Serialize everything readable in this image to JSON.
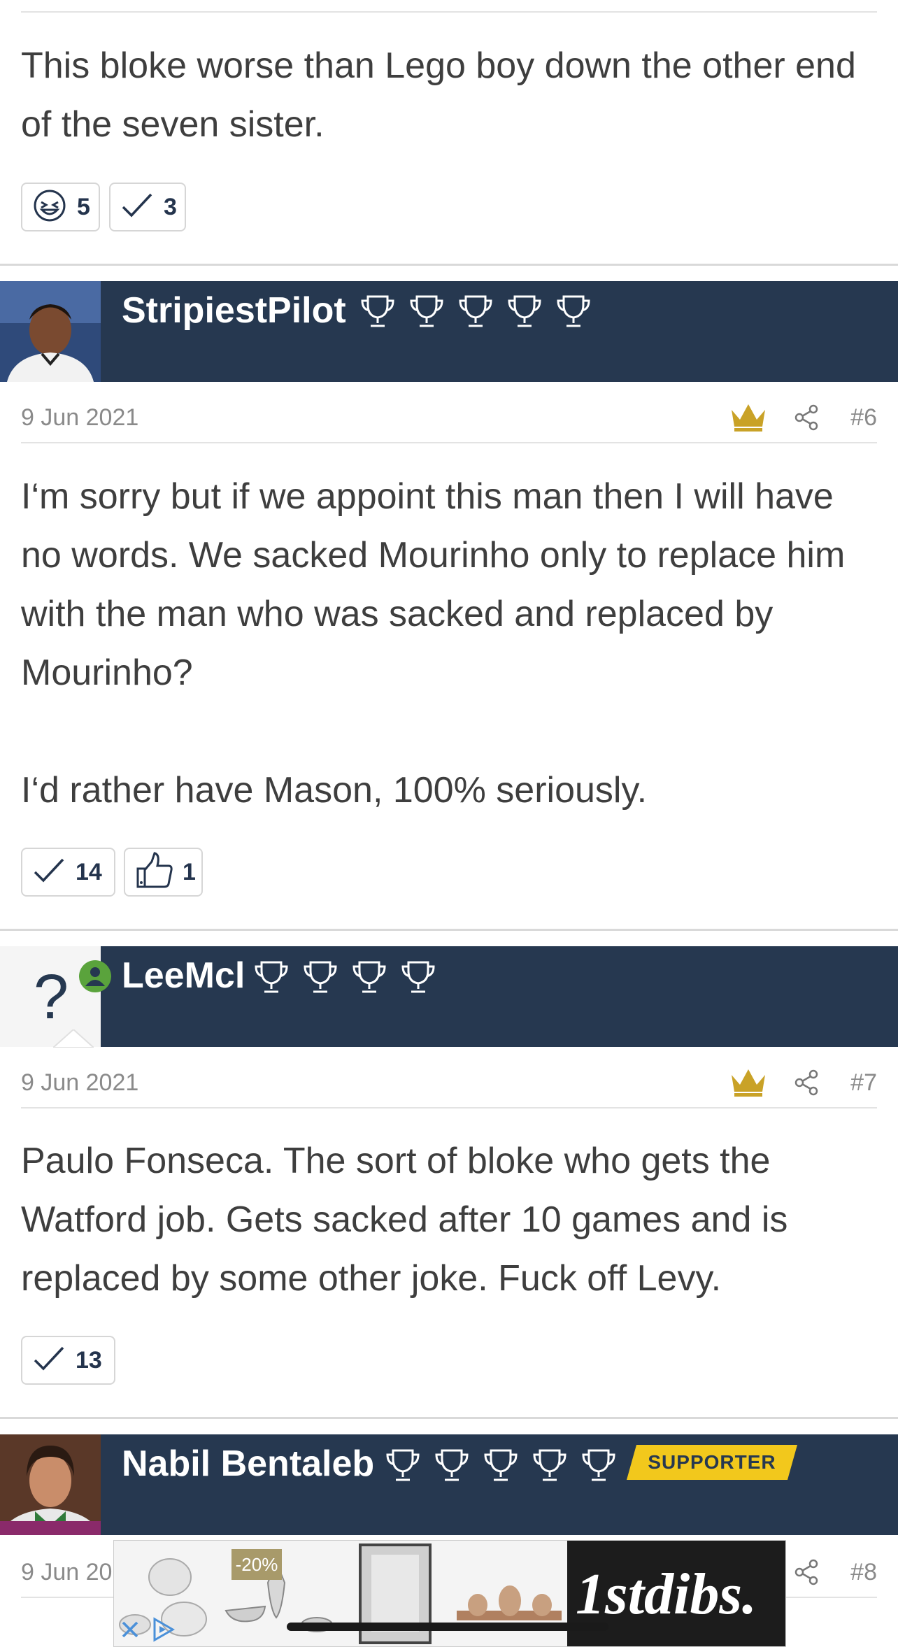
{
  "posts": [
    {
      "body": "This bloke worse than Lego boy down the other end of the seven sister.",
      "reactions": [
        {
          "icon": "laugh-icon",
          "count": "5"
        },
        {
          "icon": "check-icon",
          "count": "3"
        }
      ]
    },
    {
      "username": "StripiestPilot",
      "trophy_count": 5,
      "date": "9 Jun 2021",
      "post_number": "#6",
      "paragraphs": [
        "I‘m sorry but if we appoint this man then I will have no words. We sacked Mourinho only to replace him with the man who was sacked and replaced by Mourinho?",
        "I‘d rather have Mason, 100% seriously."
      ],
      "reactions": [
        {
          "icon": "check-icon",
          "count": "14"
        },
        {
          "icon": "thumbs-up-icon",
          "count": "1"
        }
      ]
    },
    {
      "username": "LeeMcl",
      "avatar_placeholder": "?",
      "trophy_count": 4,
      "date": "9 Jun 2021",
      "post_number": "#7",
      "body": "Paulo Fonseca. The sort of bloke who gets the Watford job. Gets sacked after 10 games and is replaced by some other joke. Fuck off Levy.",
      "reactions": [
        {
          "icon": "check-icon",
          "count": "13"
        }
      ]
    },
    {
      "username": "Nabil Bentaleb",
      "trophy_count": 5,
      "badge": "SUPPORTER",
      "date": "9 Jun 20",
      "post_number": "#8"
    }
  ],
  "ad": {
    "discount": "-20%",
    "brand": "1stdibs."
  },
  "colors": {
    "header_bg": "#263850",
    "crown": "#c9a227",
    "supporter_badge": "#f2c81c",
    "online_dot": "#5aa33c"
  }
}
